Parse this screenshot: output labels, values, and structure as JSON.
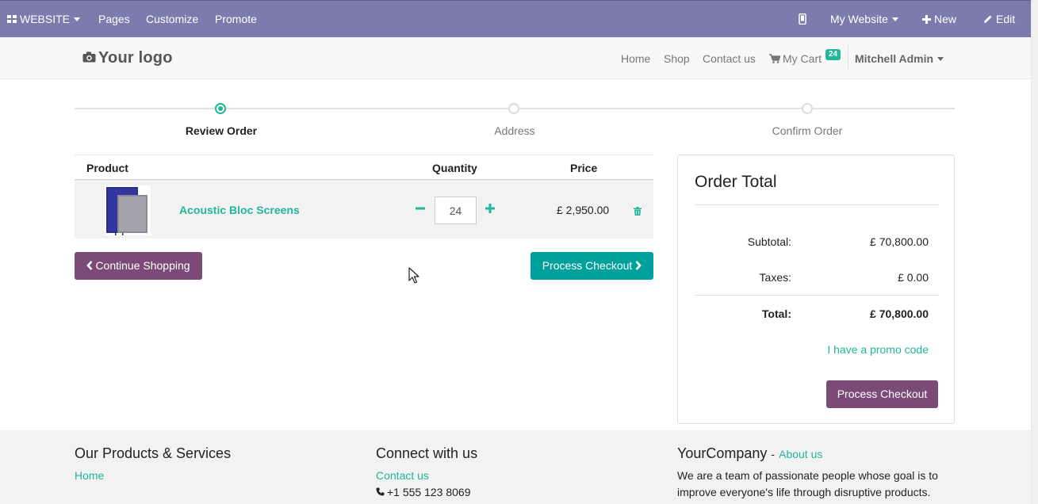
{
  "admin_bar": {
    "app_label": "WEBSITE",
    "menu": [
      "Pages",
      "Customize",
      "Promote"
    ],
    "site_selector": "My Website",
    "new_label": "New",
    "edit_label": "Edit"
  },
  "header": {
    "logo": "Your logo",
    "nav": [
      "Home",
      "Shop",
      "Contact us"
    ],
    "cart_label": "My Cart",
    "cart_count": "24",
    "user": "Mitchell Admin"
  },
  "wizard": {
    "steps": [
      "Review Order",
      "Address",
      "Confirm Order"
    ],
    "active_step": "Review Order"
  },
  "cart": {
    "headers": {
      "product": "Product",
      "quantity": "Quantity",
      "price": "Price"
    },
    "items": [
      {
        "name": "Acoustic Bloc Screens",
        "quantity": "24",
        "price": "£ 2,950.00"
      }
    ],
    "continue_label": "Continue Shopping",
    "checkout_label": "Process Checkout"
  },
  "order_total": {
    "title": "Order Total",
    "subtotal_label": "Subtotal:",
    "subtotal": "£ 70,800.00",
    "taxes_label": "Taxes:",
    "taxes": "£ 0.00",
    "total_label": "Total:",
    "total": "£ 70,800.00",
    "promo_label": "I have a promo code",
    "checkout_label": "Process Checkout"
  },
  "footer": {
    "col1_title": "Our Products & Services",
    "col1_link": "Home",
    "col2_title": "Connect with us",
    "col2_link": "Contact us",
    "col2_phone": "+1 555 123 8069",
    "col3_title": "YourCompany",
    "col3_sep": "-",
    "col3_link": "About us",
    "col3_text1": "We are a team of passionate people whose goal is to",
    "col3_text2": "improve everyone's life through disruptive products."
  },
  "colors": {
    "admin_bar": "#7c7bad",
    "accent_teal": "#21b799",
    "button_teal": "#00a09d",
    "button_purple": "#7c4a76"
  }
}
